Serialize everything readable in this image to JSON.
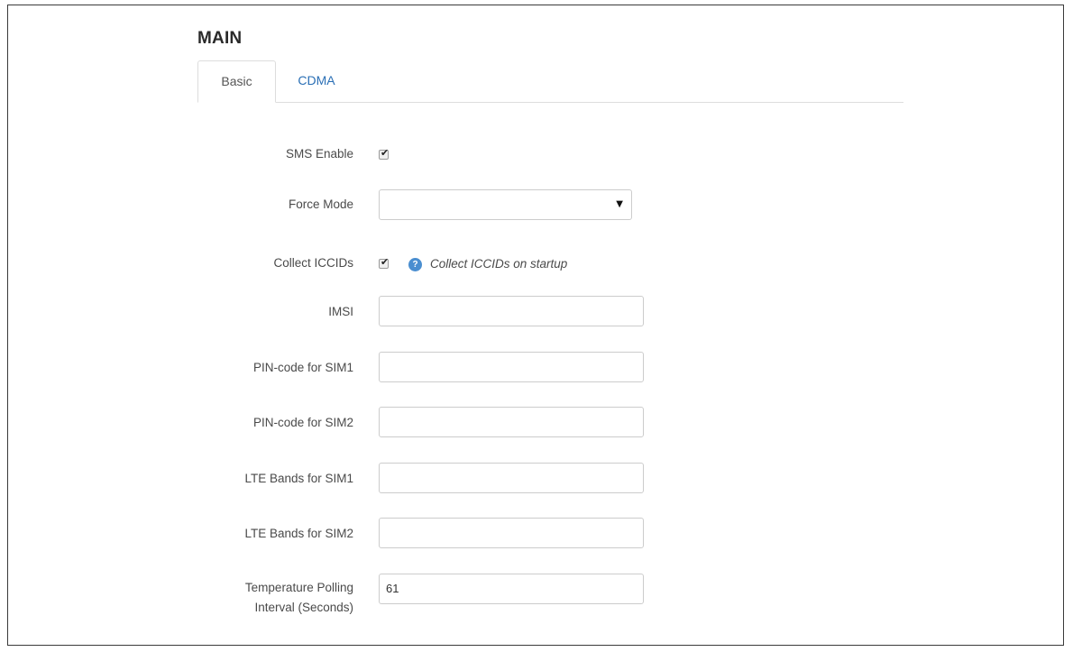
{
  "section": {
    "title": "MAIN"
  },
  "tabs": [
    {
      "label": "Basic",
      "active": true
    },
    {
      "label": "CDMA",
      "active": false
    }
  ],
  "form": {
    "sms_enable": {
      "label": "SMS Enable",
      "checked": true
    },
    "force_mode": {
      "label": "Force Mode",
      "value": ""
    },
    "collect_iccids": {
      "label": "Collect ICCIDs",
      "checked": true,
      "help": "Collect ICCIDs on startup"
    },
    "imsi": {
      "label": "IMSI",
      "value": ""
    },
    "pin_sim1": {
      "label": "PIN-code for SIM1",
      "value": ""
    },
    "pin_sim2": {
      "label": "PIN-code for SIM2",
      "value": ""
    },
    "lte_sim1": {
      "label": "LTE Bands for SIM1",
      "value": ""
    },
    "lte_sim2": {
      "label": "LTE Bands for SIM2",
      "value": ""
    },
    "temp_polling": {
      "label_line1": "Temperature Polling",
      "label_line2": "Interval (Seconds)",
      "value": "61"
    }
  },
  "icons": {
    "checkbox_tick": "✔",
    "dropdown_arrow": "▼",
    "help": "?"
  },
  "colors": {
    "tab_link": "#2a6fb5",
    "help_icon": "#4a8ed0"
  }
}
